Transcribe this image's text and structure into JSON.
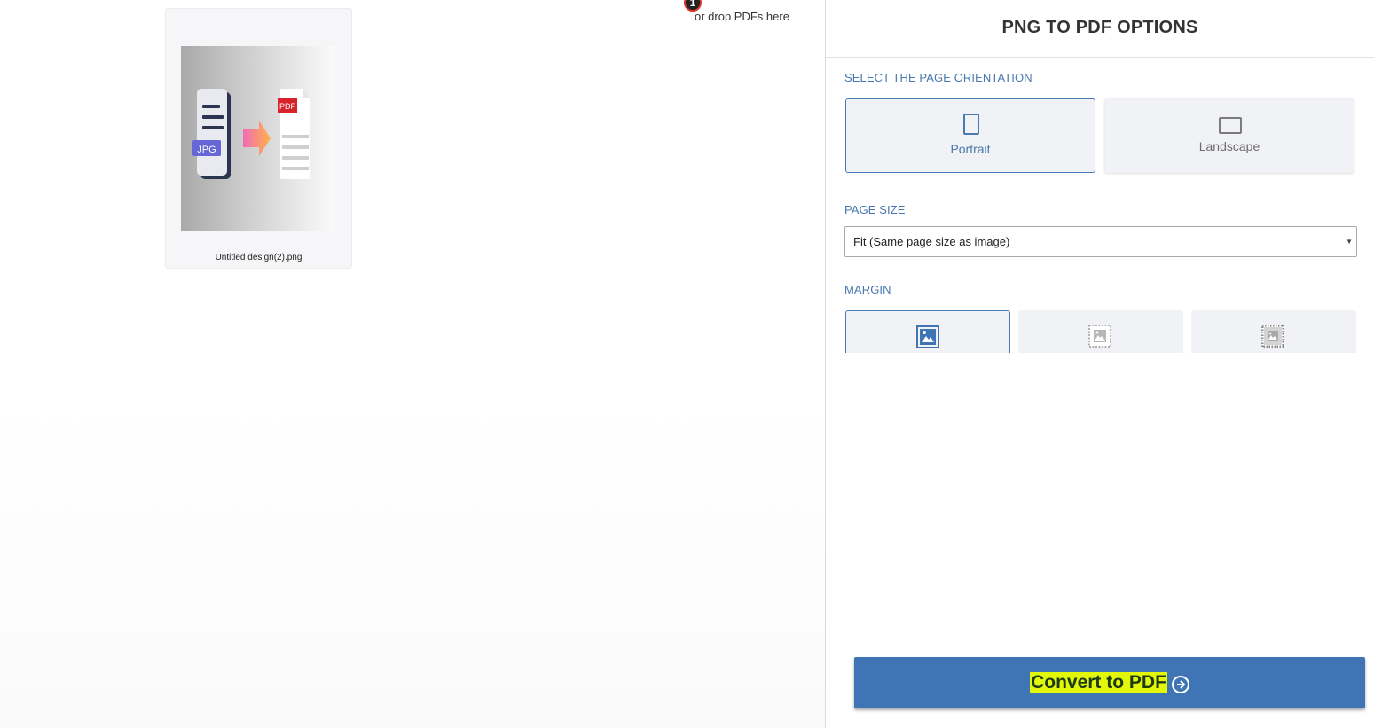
{
  "workspace": {
    "file_count": "1",
    "drop_hint": "or drop PDFs here",
    "files": [
      {
        "name": "Untitled design(2).png",
        "thumb_badges": {
          "source": "JPG",
          "target": "PDF"
        }
      }
    ]
  },
  "sidebar": {
    "title": "PNG TO PDF OPTIONS",
    "orientation": {
      "label": "SELECT THE PAGE ORIENTATION",
      "options": [
        {
          "label": "Portrait",
          "selected": true
        },
        {
          "label": "Landscape",
          "selected": false
        }
      ]
    },
    "page_size": {
      "label": "PAGE SIZE",
      "selected": "Fit (Same page size as image)"
    },
    "margin": {
      "label": "MARGIN",
      "options": [
        {
          "icon": "no-margin-image-icon",
          "selected": true
        },
        {
          "icon": "small-margin-image-icon",
          "selected": false
        },
        {
          "icon": "big-margin-image-icon",
          "selected": false
        }
      ]
    },
    "convert": {
      "label": "Convert to PDF",
      "icon": "arrow-circle-right-icon"
    }
  },
  "colors": {
    "accent": "#3f74b5",
    "section_label": "#4a78ae",
    "highlight": "#e3f70a",
    "badge_border": "#d8322a"
  }
}
